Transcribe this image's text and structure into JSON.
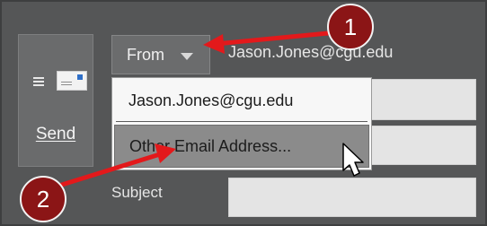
{
  "send": {
    "label": "Send",
    "icon": "envelope-icon"
  },
  "from": {
    "label": "From",
    "caret_icon": "chevron-down-icon",
    "value": "Jason.Jones@cgu.edu"
  },
  "dropdown": {
    "items": [
      "Jason.Jones@cgu.edu",
      "Other Email Address..."
    ],
    "highlighted_index": 1
  },
  "subject": {
    "label": "Subject"
  },
  "annotations": [
    {
      "number": "1",
      "color": "#8b1516"
    },
    {
      "number": "2",
      "color": "#8b1516"
    }
  ],
  "colors": {
    "arrow": "#e3191b",
    "background": "#555657"
  }
}
